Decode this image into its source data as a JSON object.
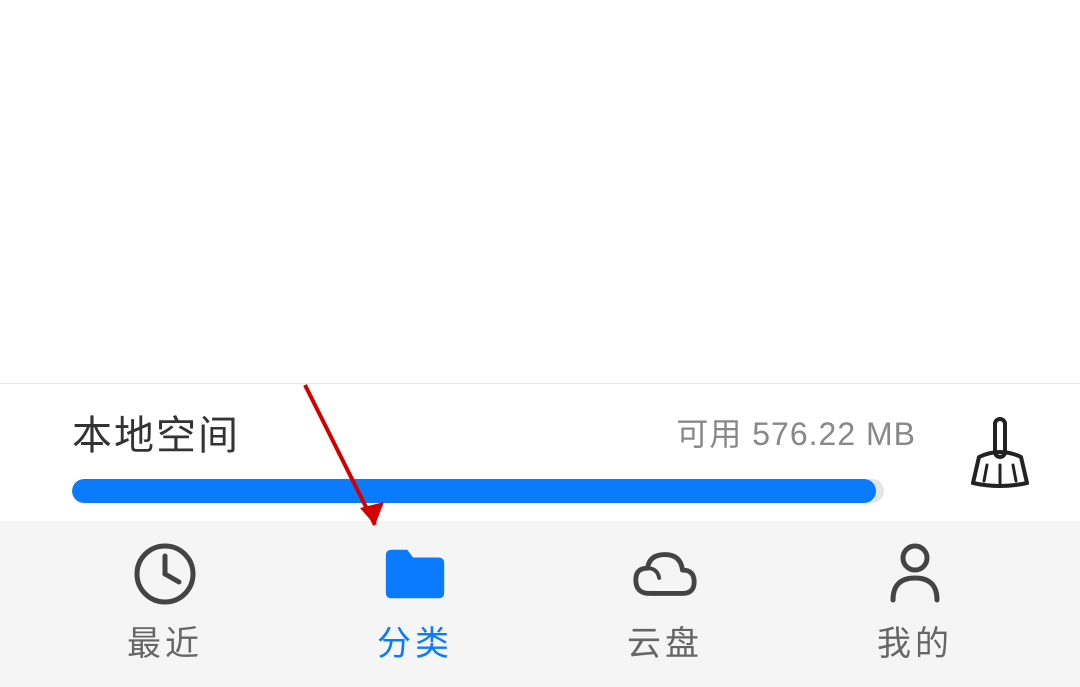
{
  "storage": {
    "title": "本地空间",
    "available_prefix": "可用",
    "available_value": "576.22 MB",
    "progress_percent": 99
  },
  "tabs": {
    "recent": {
      "label": "最近"
    },
    "category": {
      "label": "分类",
      "active": true
    },
    "cloud": {
      "label": "云盘"
    },
    "mine": {
      "label": "我的"
    }
  },
  "colors": {
    "accent": "#0a7aff",
    "text_primary": "#333333",
    "text_secondary": "#888888",
    "background": "#ffffff",
    "tab_background": "#f5f5f5"
  }
}
